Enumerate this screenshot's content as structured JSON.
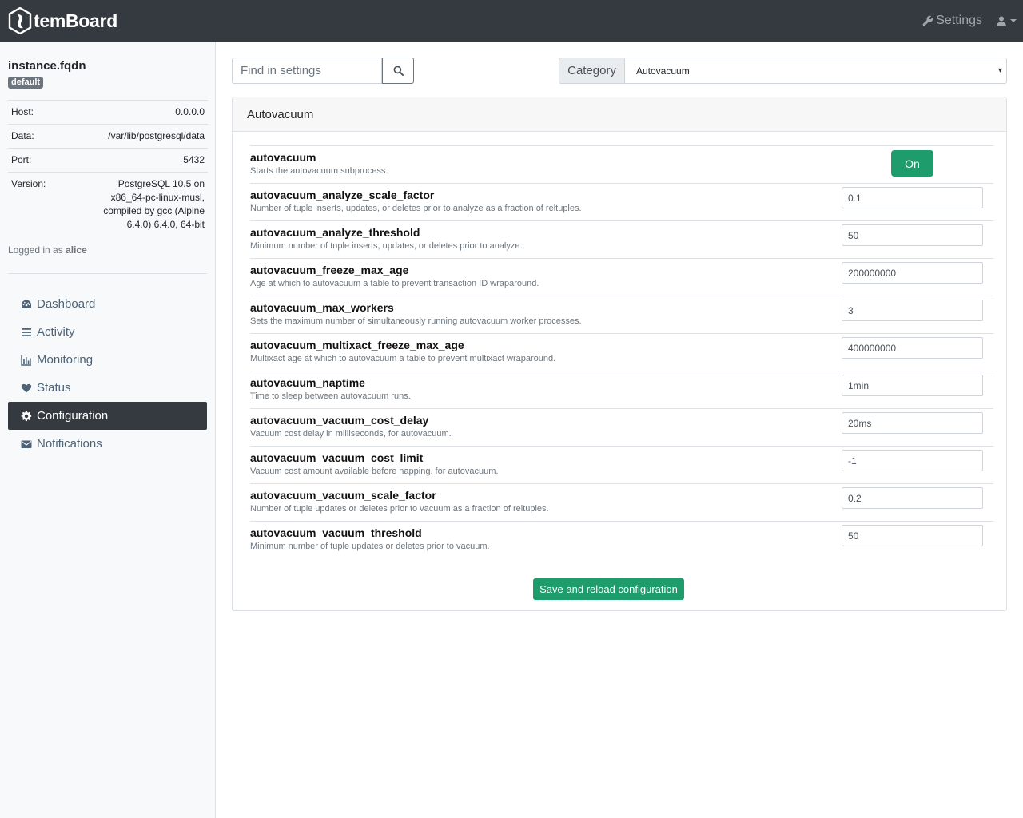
{
  "navbar": {
    "brand": "temBoard",
    "settings_label": "Settings"
  },
  "sidebar": {
    "instance_name": "instance.fqdn",
    "environment_badge": "default",
    "info": [
      {
        "key": "Host:",
        "value": "0.0.0.0"
      },
      {
        "key": "Data:",
        "value": "/var/lib/postgresql/data"
      },
      {
        "key": "Port:",
        "value": "5432"
      },
      {
        "key": "Version:",
        "value": "PostgreSQL 10.5 on x86_64-pc-linux-musl, compiled by gcc (Alpine 6.4.0) 6.4.0, 64-bit"
      }
    ],
    "logged_in_prefix": "Logged in as",
    "logged_in_user": "alice",
    "nav": [
      {
        "label": "Dashboard",
        "icon": "dashboard-icon",
        "active": false
      },
      {
        "label": "Activity",
        "icon": "list-icon",
        "active": false
      },
      {
        "label": "Monitoring",
        "icon": "bar-chart-icon",
        "active": false
      },
      {
        "label": "Status",
        "icon": "heart-icon",
        "active": false
      },
      {
        "label": "Configuration",
        "icon": "gear-icon",
        "active": true
      },
      {
        "label": "Notifications",
        "icon": "envelope-icon",
        "active": false
      }
    ]
  },
  "toolbar": {
    "search_placeholder": "Find in settings",
    "category_label": "Category",
    "category_value": "Autovacuum"
  },
  "section": {
    "title": "Autovacuum",
    "settings": [
      {
        "name": "autovacuum",
        "description": "Starts the autovacuum subprocess.",
        "type": "toggle",
        "value": "On"
      },
      {
        "name": "autovacuum_analyze_scale_factor",
        "description": "Number of tuple inserts, updates, or deletes prior to analyze as a fraction of reltuples.",
        "type": "text",
        "value": "0.1"
      },
      {
        "name": "autovacuum_analyze_threshold",
        "description": "Minimum number of tuple inserts, updates, or deletes prior to analyze.",
        "type": "text",
        "value": "50"
      },
      {
        "name": "autovacuum_freeze_max_age",
        "description": "Age at which to autovacuum a table to prevent transaction ID wraparound.",
        "type": "text",
        "value": "200000000"
      },
      {
        "name": "autovacuum_max_workers",
        "description": "Sets the maximum number of simultaneously running autovacuum worker processes.",
        "type": "text",
        "value": "3"
      },
      {
        "name": "autovacuum_multixact_freeze_max_age",
        "description": "Multixact age at which to autovacuum a table to prevent multixact wraparound.",
        "type": "text",
        "value": "400000000"
      },
      {
        "name": "autovacuum_naptime",
        "description": "Time to sleep between autovacuum runs.",
        "type": "text",
        "value": "1min"
      },
      {
        "name": "autovacuum_vacuum_cost_delay",
        "description": "Vacuum cost delay in milliseconds, for autovacuum.",
        "type": "text",
        "value": "20ms"
      },
      {
        "name": "autovacuum_vacuum_cost_limit",
        "description": "Vacuum cost amount available before napping, for autovacuum.",
        "type": "text",
        "value": "-1"
      },
      {
        "name": "autovacuum_vacuum_scale_factor",
        "description": "Number of tuple updates or deletes prior to vacuum as a fraction of reltuples.",
        "type": "text",
        "value": "0.2"
      },
      {
        "name": "autovacuum_vacuum_threshold",
        "description": "Minimum number of tuple updates or deletes prior to vacuum.",
        "type": "text",
        "value": "50"
      }
    ],
    "save_label": "Save and reload configuration"
  },
  "colors": {
    "navbar_bg": "#343a40",
    "accent_green": "#1e9c6c",
    "nav_link": "#4e6378"
  }
}
